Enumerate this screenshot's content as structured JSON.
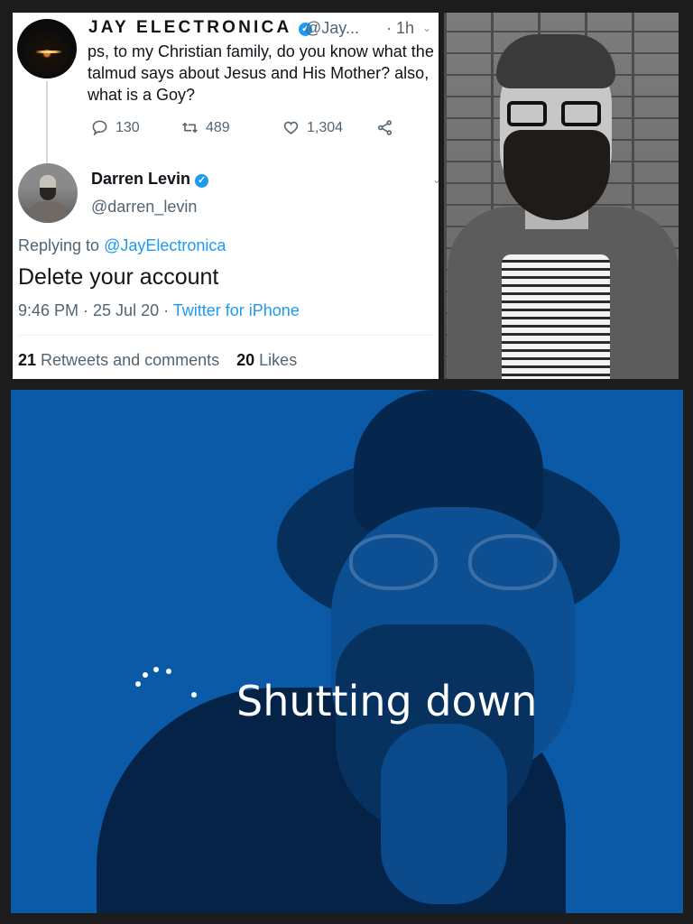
{
  "tweet": {
    "author_name": "JAY ELECTRONICA",
    "author_handle": "@Jay...",
    "time": "· 1h",
    "text": "ps, to my Christian family, do you know what the talmud says about Jesus and His Mother? also, what is a Goy?",
    "replies": "130",
    "retweets": "489",
    "likes": "1,304"
  },
  "reply": {
    "author_name": "Darren Levin",
    "author_handle": "@darren_levin",
    "replying_prefix": "Replying to ",
    "replying_to": "@JayElectronica",
    "text": "Delete your account",
    "time": "9:46 PM · 25 Jul 20 · ",
    "source": "Twitter for iPhone",
    "retweets_count": "21",
    "retweets_label": " Retweets and comments",
    "likes_count": "20",
    "likes_label": " Likes"
  },
  "meme": {
    "caption": "Shutting down"
  },
  "icons": {
    "reply": "reply-icon",
    "retweet": "retweet-icon",
    "like": "heart-icon",
    "share": "share-icon",
    "verified": "verified-badge-icon"
  },
  "colors": {
    "link": "#1d9bf0",
    "meme_background": "#0b5aa7"
  }
}
